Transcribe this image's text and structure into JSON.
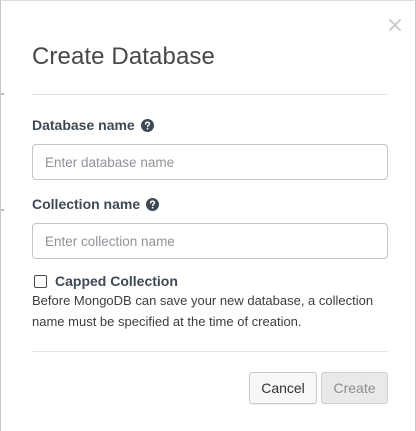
{
  "modal": {
    "title": "Create Database",
    "database": {
      "label": "Database name",
      "placeholder": "Enter database name",
      "value": ""
    },
    "collection": {
      "label": "Collection name",
      "placeholder": "Enter collection name",
      "value": ""
    },
    "capped": {
      "label": "Capped Collection",
      "checked": false
    },
    "note": "Before MongoDB can save your new database, a collection name must be specified at the time of creation.",
    "buttons": {
      "cancel": "Cancel",
      "create": "Create"
    }
  },
  "icons": {
    "close": "close-icon",
    "help": "question-circle-icon"
  }
}
